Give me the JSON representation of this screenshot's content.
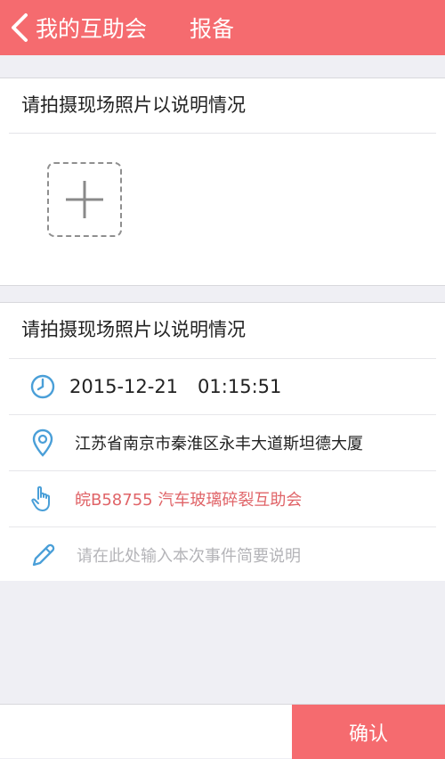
{
  "header": {
    "back_label": "我的互助会",
    "title": "报备",
    "background": "#f56b6f"
  },
  "photo_section": {
    "title": "请拍摄现场照片以说明情况",
    "add_icon": "plus-icon"
  },
  "info_section": {
    "title": "请拍摄现场照片以说明情况",
    "date": "2015-12-21",
    "time": "01:15:51",
    "address": "江苏省南京市秦淮区永丰大道斯坦德大厦",
    "plate_group": "皖B58755 汽车玻璃碎裂互助会",
    "description_placeholder": "请在此处输入本次事件简要说明",
    "icons": {
      "time": "clock-icon",
      "location": "location-pin-icon",
      "group": "hand-pointer-icon",
      "description": "pencil-icon"
    },
    "accent_color": "#4a9fd8",
    "plate_color": "#e06468"
  },
  "footer": {
    "confirm_label": "确认"
  }
}
